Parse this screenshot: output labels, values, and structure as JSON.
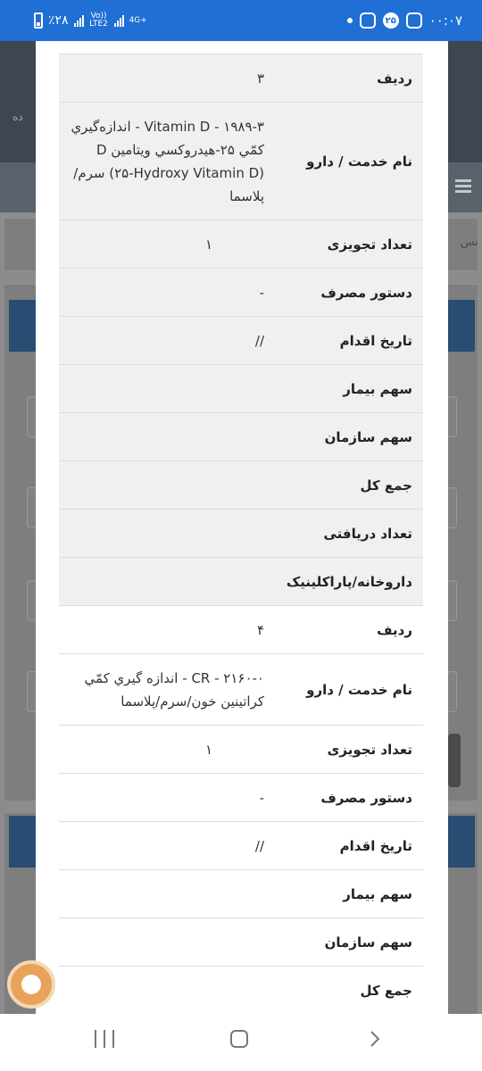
{
  "status_bar": {
    "time": "۰۰:۰۷",
    "notification_badge": "۲۵",
    "battery": "٪۲۸",
    "network_label_1": "Vo)) LTE2",
    "network_label_2": "4G+"
  },
  "background_page": {
    "header_fragment": "ده",
    "row_fragment": "نس"
  },
  "modal": {
    "records": [
      {
        "row_number": {
          "label": "ردیف",
          "value": "۳"
        },
        "service_name": {
          "label": "نام خدمت / دارو",
          "value": "۱۹۸۹-۳ - Vitamin D - اندازه‌گيري كمّي ۲۵-هيدروكسي ويتامين D (۲۵-Hydroxy Vitamin D) سرم/پلاسما"
        },
        "prescribed_qty": {
          "label": "تعداد تجویزی",
          "value": "۱"
        },
        "usage_instruction": {
          "label": "دستور مصرف",
          "value": "-"
        },
        "action_date": {
          "label": "تاریخ اقدام",
          "value": "//"
        },
        "patient_share": {
          "label": "سهم بیمار",
          "value": ""
        },
        "org_share": {
          "label": "سهم سازمان",
          "value": ""
        },
        "total": {
          "label": "جمع کل",
          "value": ""
        },
        "received_qty": {
          "label": "تعداد دریافتی",
          "value": ""
        },
        "pharmacy": {
          "label": "داروخانه/پاراکلینیک",
          "value": ""
        }
      },
      {
        "row_number": {
          "label": "ردیف",
          "value": "۴"
        },
        "service_name": {
          "label": "نام خدمت / دارو",
          "value": "۲۱۶۰-۰ - CR - اندازه گيري كمّي كراتينين خون/سرم/پلاسما"
        },
        "prescribed_qty": {
          "label": "تعداد تجویزی",
          "value": "۱"
        },
        "usage_instruction": {
          "label": "دستور مصرف",
          "value": "-"
        },
        "action_date": {
          "label": "تاریخ اقدام",
          "value": "//"
        },
        "patient_share": {
          "label": "سهم بیمار",
          "value": ""
        },
        "org_share": {
          "label": "سهم سازمان",
          "value": ""
        },
        "total": {
          "label": "جمع کل",
          "value": ""
        }
      }
    ]
  },
  "colors": {
    "status_bar": "#1f6fd4",
    "shaded_row": "#f0f0f0",
    "border": "#dcdcdc"
  },
  "icons": [
    "instagram-icon",
    "image-icon",
    "home-circle-icon",
    "back-chevron-icon",
    "recent-apps-icon",
    "assistant-icon"
  ]
}
